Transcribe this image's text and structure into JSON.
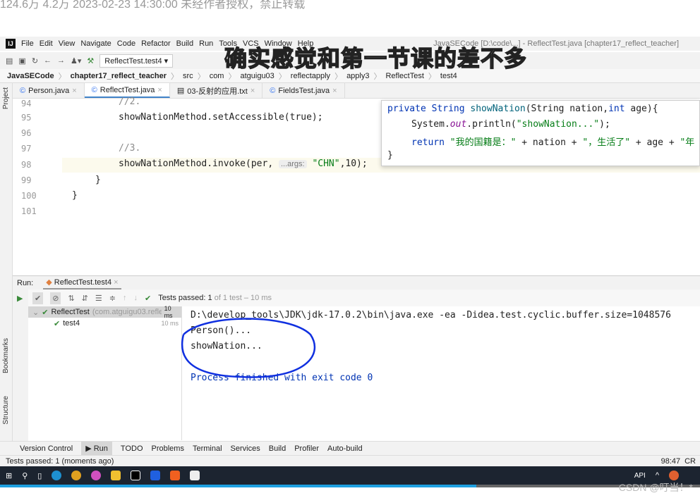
{
  "video_meta": "124.6万   4.2万   2023-02-23 14:30:00   未经作者授权，禁止转载",
  "subtitle": "确实感觉和第一节课的差不多",
  "menu": [
    "File",
    "Edit",
    "View",
    "Navigate",
    "Code",
    "Refactor",
    "Build",
    "Run",
    "Tools",
    "VCS",
    "Window",
    "Help"
  ],
  "window_title": "JavaSECode [D:\\code\\...] - ReflectTest.java [chapter17_reflect_teacher]",
  "run_config": "ReflectTest.test4",
  "breadcrumb": [
    "JavaSECode",
    "chapter17_reflect_teacher",
    "src",
    "com",
    "atguigu03",
    "reflectapply",
    "apply3",
    "ReflectTest",
    "test4"
  ],
  "editor_tabs": [
    "Person.java",
    "ReflectTest.java",
    "03-反射的应用.txt",
    "FieldsTest.java"
  ],
  "active_tab": 1,
  "side_labels": {
    "project": "Project",
    "bookmarks": "Bookmarks",
    "structure": "Structure"
  },
  "code_lines": [
    {
      "n": "94",
      "text": "//2.",
      "type": "cm"
    },
    {
      "n": "95",
      "text": "showNationMethod.setAccessible(true);"
    },
    {
      "n": "96",
      "text": ""
    },
    {
      "n": "97",
      "text": "//3.",
      "type": "cm"
    },
    {
      "n": "98",
      "pre": "showNationMethod.invoke(per, ",
      "hint": "...args:",
      "str": "\"CHN\"",
      "post": ",10);"
    },
    {
      "n": "99",
      "text": "}"
    },
    {
      "n": "100",
      "text": "}"
    },
    {
      "n": "101",
      "text": ""
    }
  ],
  "popup": {
    "l1a": "private String ",
    "l1b": "showNation",
    "l1c": "(String nation,",
    "l1d": "int",
    " l1e": " age){",
    "l2a": "System.",
    "l2b": "out",
    "l2c": ".println(",
    "l2d": "\"showNation...\"",
    "l2e": ");",
    "l3a": "return ",
    "l3b": "\"我的国籍是：\"",
    "l3c": " + nation + ",
    "l3d": "\"，生活了\"",
    "l3e": " + age + ",
    "l3f": "\"年",
    "l4": "}"
  },
  "run": {
    "label": "Run:",
    "tab": "ReflectTest.test4",
    "result_prefix": "Tests passed: ",
    "result_count": "1",
    "result_suffix": " of 1 test – 10 ms",
    "tree": [
      {
        "name": "ReflectTest",
        "pkg": "(com.atguigu03.refle",
        "time": "10 ms"
      },
      {
        "name": "test4",
        "time": "10 ms"
      }
    ],
    "console": [
      "D:\\develop_tools\\JDK\\jdk-17.0.2\\bin\\java.exe -ea -Didea.test.cyclic.buffer.size=1048576",
      "Person()...",
      "showNation...",
      "",
      "Process finished with exit code 0"
    ]
  },
  "bottom_tools": [
    "Version Control",
    "Run",
    "TODO",
    "Problems",
    "Terminal",
    "Services",
    "Build",
    "Profiler",
    "Auto-build"
  ],
  "status": {
    "message": "Tests passed: 1 (moments ago)",
    "position": "98:47",
    "line_sep": "CR"
  },
  "taskbar": {
    "tray_text": "API"
  },
  "watermark": "CSDN @叮当！*",
  "video_progress": 0.68
}
